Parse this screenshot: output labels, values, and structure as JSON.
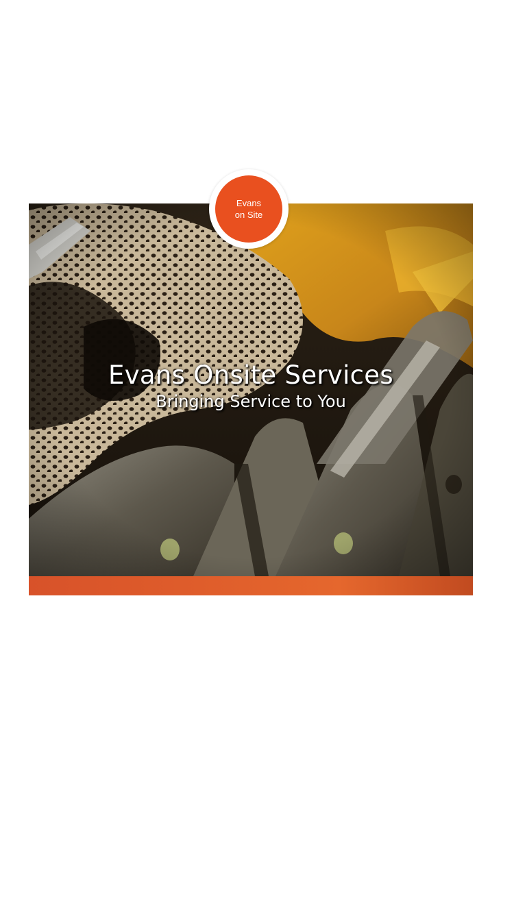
{
  "logo": {
    "line1": "Evans",
    "line2": "on Site"
  },
  "hero": {
    "title": "Evans Onsite Services",
    "subtitle": "Bringing Service to You",
    "image_icon": "work-glove-machinery-photo"
  },
  "colors": {
    "accent": "#e9501f",
    "band": "#e8602c",
    "text_on_image": "#ffffff",
    "background": "#ffffff"
  }
}
